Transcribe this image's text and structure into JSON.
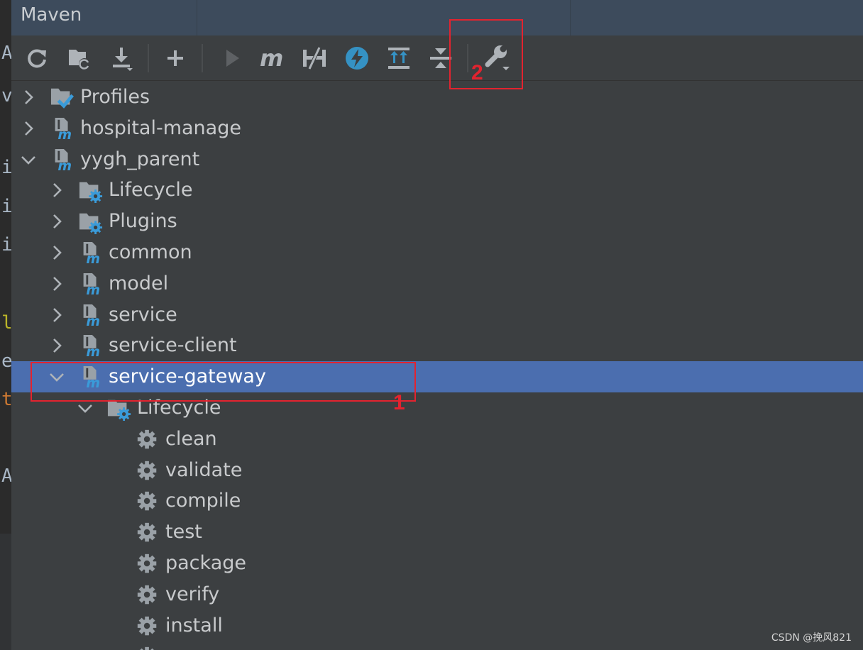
{
  "panel": {
    "title": "Maven"
  },
  "gutter_chars": [
    "A",
    "v",
    "i",
    "i",
    "i",
    "l",
    "e",
    "t",
    "A"
  ],
  "toolbar": [
    {
      "name": "reload-all-projects-button",
      "icon": "refresh-icon"
    },
    {
      "name": "generate-sources-button",
      "icon": "folder-refresh-icon"
    },
    {
      "name": "download-sources-button",
      "icon": "download-icon"
    },
    {
      "name": "add-maven-project-button",
      "icon": "plus-icon"
    },
    {
      "name": "run-maven-build-button",
      "icon": "play-icon"
    },
    {
      "name": "execute-maven-goal-button",
      "icon": "maven-m-icon"
    },
    {
      "name": "toggle-offline-mode-button",
      "icon": "offline-icon"
    },
    {
      "name": "skip-tests-button",
      "icon": "lightning-icon"
    },
    {
      "name": "show-dependencies-button",
      "icon": "expand-all-icon"
    },
    {
      "name": "collapse-all-button",
      "icon": "collapse-all-icon"
    },
    {
      "name": "maven-settings-button",
      "icon": "wrench-icon"
    }
  ],
  "tree": [
    {
      "label": "Profiles",
      "icon": "profiles-icon",
      "expanded": false,
      "depth": 0
    },
    {
      "label": "hospital-manage",
      "icon": "maven-module-icon",
      "expanded": false,
      "depth": 0
    },
    {
      "label": "yygh_parent",
      "icon": "maven-module-icon",
      "expanded": true,
      "depth": 0
    },
    {
      "label": "Lifecycle",
      "icon": "lifecycle-folder-icon",
      "expanded": false,
      "depth": 1
    },
    {
      "label": "Plugins",
      "icon": "plugins-folder-icon",
      "expanded": false,
      "depth": 1
    },
    {
      "label": "common",
      "icon": "maven-module-icon",
      "expanded": false,
      "depth": 1
    },
    {
      "label": "model",
      "icon": "maven-module-icon",
      "expanded": false,
      "depth": 1
    },
    {
      "label": "service",
      "icon": "maven-module-icon",
      "expanded": false,
      "depth": 1
    },
    {
      "label": "service-client",
      "icon": "maven-module-icon",
      "expanded": false,
      "depth": 1
    },
    {
      "label": "service-gateway",
      "icon": "maven-module-icon",
      "expanded": true,
      "depth": 1,
      "selected": true
    },
    {
      "label": "Lifecycle",
      "icon": "lifecycle-folder-icon",
      "expanded": true,
      "depth": 2
    },
    {
      "label": "clean",
      "icon": "gear-icon",
      "depth": 3
    },
    {
      "label": "validate",
      "icon": "gear-icon",
      "depth": 3
    },
    {
      "label": "compile",
      "icon": "gear-icon",
      "depth": 3
    },
    {
      "label": "test",
      "icon": "gear-icon",
      "depth": 3
    },
    {
      "label": "package",
      "icon": "gear-icon",
      "depth": 3
    },
    {
      "label": "verify",
      "icon": "gear-icon",
      "depth": 3
    },
    {
      "label": "install",
      "icon": "gear-icon",
      "depth": 3
    },
    {
      "label": "",
      "icon": "gear-icon",
      "depth": 3
    }
  ],
  "annotations": {
    "first": "1",
    "second": "2"
  },
  "watermark": "CSDN @挽风821",
  "colors": {
    "selection": "#4b6eaf",
    "annotation": "#e3232f",
    "maven_blue": "#3a9bd9"
  }
}
